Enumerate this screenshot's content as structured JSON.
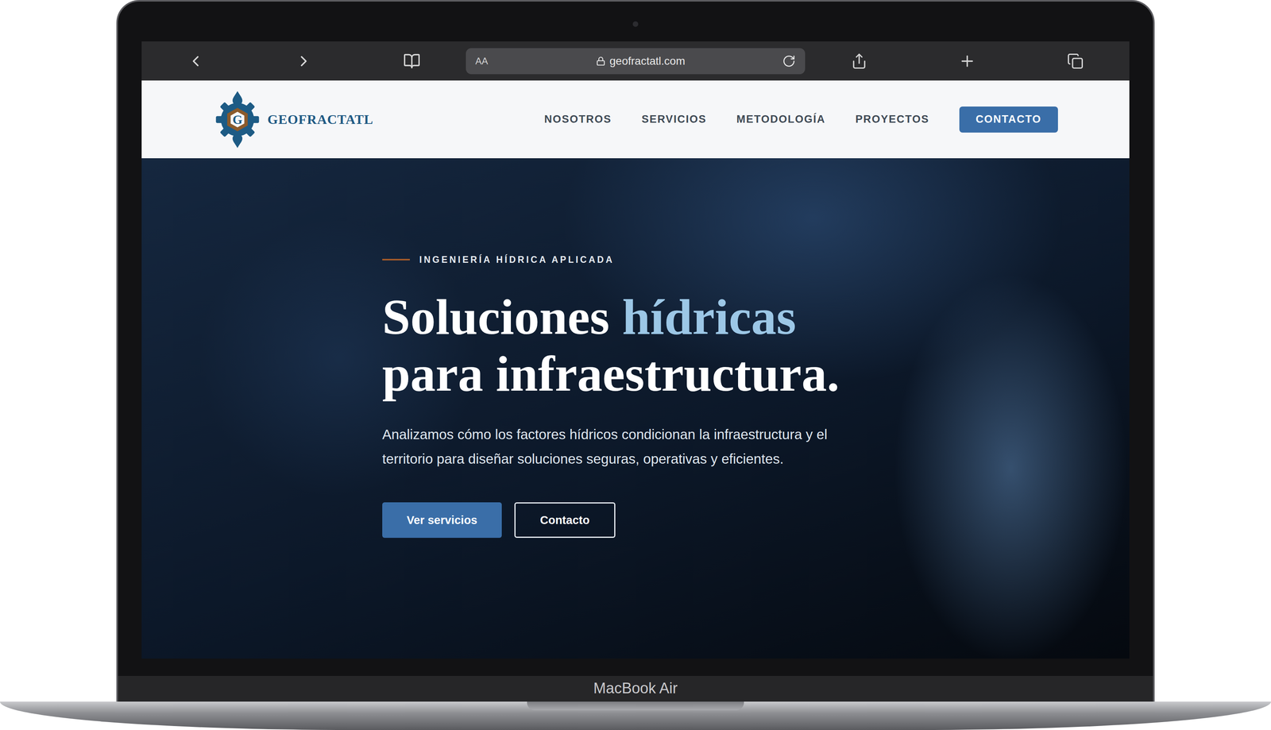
{
  "browser": {
    "text_size_button": "AA",
    "url": "geofractatl.com"
  },
  "site_header": {
    "logo": {
      "mark": "G",
      "name": "GEOFRACTATL"
    },
    "nav": [
      {
        "label": "NOSOTROS"
      },
      {
        "label": "SERVICIOS"
      },
      {
        "label": "METODOLOGÍA"
      },
      {
        "label": "PROYECTOS"
      }
    ],
    "cta": "CONTACTO"
  },
  "hero": {
    "eyebrow": "INGENIERÍA HÍDRICA APLICADA",
    "title": {
      "line1": "Soluciones",
      "highlight": "hídricas",
      "line2": "para infraestructura."
    },
    "description": "Analizamos cómo los factores hídricos condicionan la infraestructura y el territorio para diseñar soluciones seguras, operativas y eficientes.",
    "buttons": [
      {
        "label": "Ver servicios",
        "kind": "primary"
      },
      {
        "label": "Contacto",
        "kind": "outline"
      }
    ]
  },
  "device": {
    "label": "MacBook Air"
  }
}
